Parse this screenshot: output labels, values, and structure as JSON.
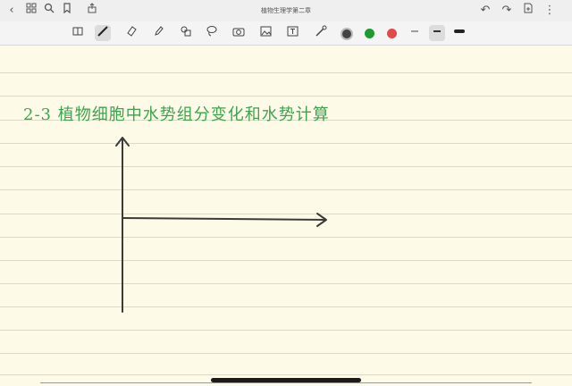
{
  "top_bar": {
    "title": "植物生理学第二章"
  },
  "toolbar": {
    "colors": [
      "#444444",
      "#1f9a2e",
      "#e24a4a"
    ],
    "active_tool": "pen",
    "selected_stroke": "medium"
  },
  "note": {
    "heading": "2-3 植物细胞中水势组分变化和水势计算",
    "heading_color": "#3fa34d",
    "drawing": "axes"
  }
}
